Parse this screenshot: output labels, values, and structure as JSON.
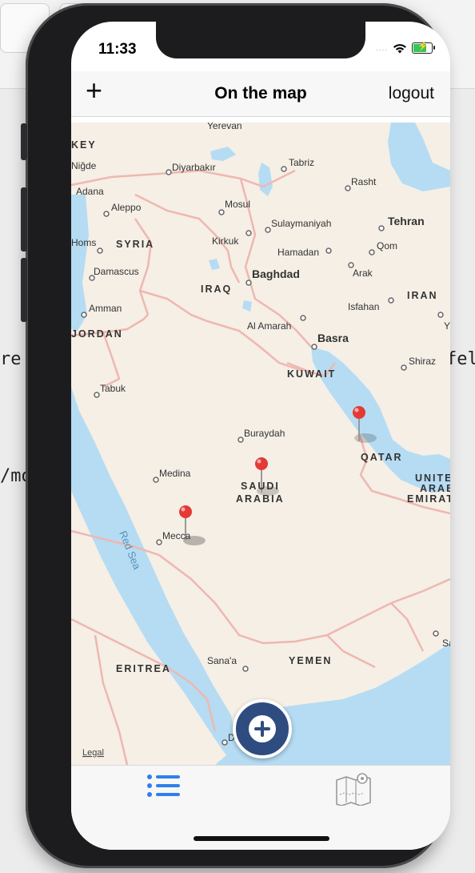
{
  "background": {
    "left_text_1": "re",
    "left_text_2": "/mo",
    "right_text_1": "fel"
  },
  "status_bar": {
    "time": "11:33"
  },
  "nav_bar": {
    "title": "On the map",
    "logout_label": "logout",
    "add_icon": "plus-icon"
  },
  "map": {
    "legal_label": "Legal",
    "water_label": "Red Sea",
    "countries": [
      "KEY",
      "SYRIA",
      "IRAQ",
      "IRAN",
      "JORDAN",
      "KUWAIT",
      "SAUDI",
      "ARABIA",
      "QATAR",
      "UNITE",
      "ARAB",
      "EMIRAT",
      "ERITREA",
      "YEMEN"
    ],
    "cities": [
      "Yerevan",
      "Diyarbakır",
      "Tabriz",
      "Rasht",
      "Adana",
      "Niğde",
      "Aleppo",
      "Mosul",
      "Sulaymaniyah",
      "Tehran",
      "Homs",
      "Kirkuk",
      "Qom",
      "Hamadan",
      "Damascus",
      "Arak",
      "Baghdad",
      "Amman",
      "Isfahan",
      "Al Amarah",
      "Basra",
      "Shiraz",
      "Tabuk",
      "Buraydah",
      "Medina",
      "Mecca",
      "Sana'a",
      "Y",
      "Sa",
      "D"
    ],
    "pins": 3
  },
  "fab": {
    "icon": "plus-circle-icon"
  },
  "tab_bar": {
    "list_icon": "list-icon",
    "map_icon": "map-icon"
  },
  "colors": {
    "land": "#f5efe6",
    "water": "#b5dcf3",
    "border": "#efb7b0",
    "pin": "#e53935",
    "fab": "#2f4c80",
    "tab_active": "#2f80ed",
    "tab_inactive": "#9a9a9a"
  }
}
